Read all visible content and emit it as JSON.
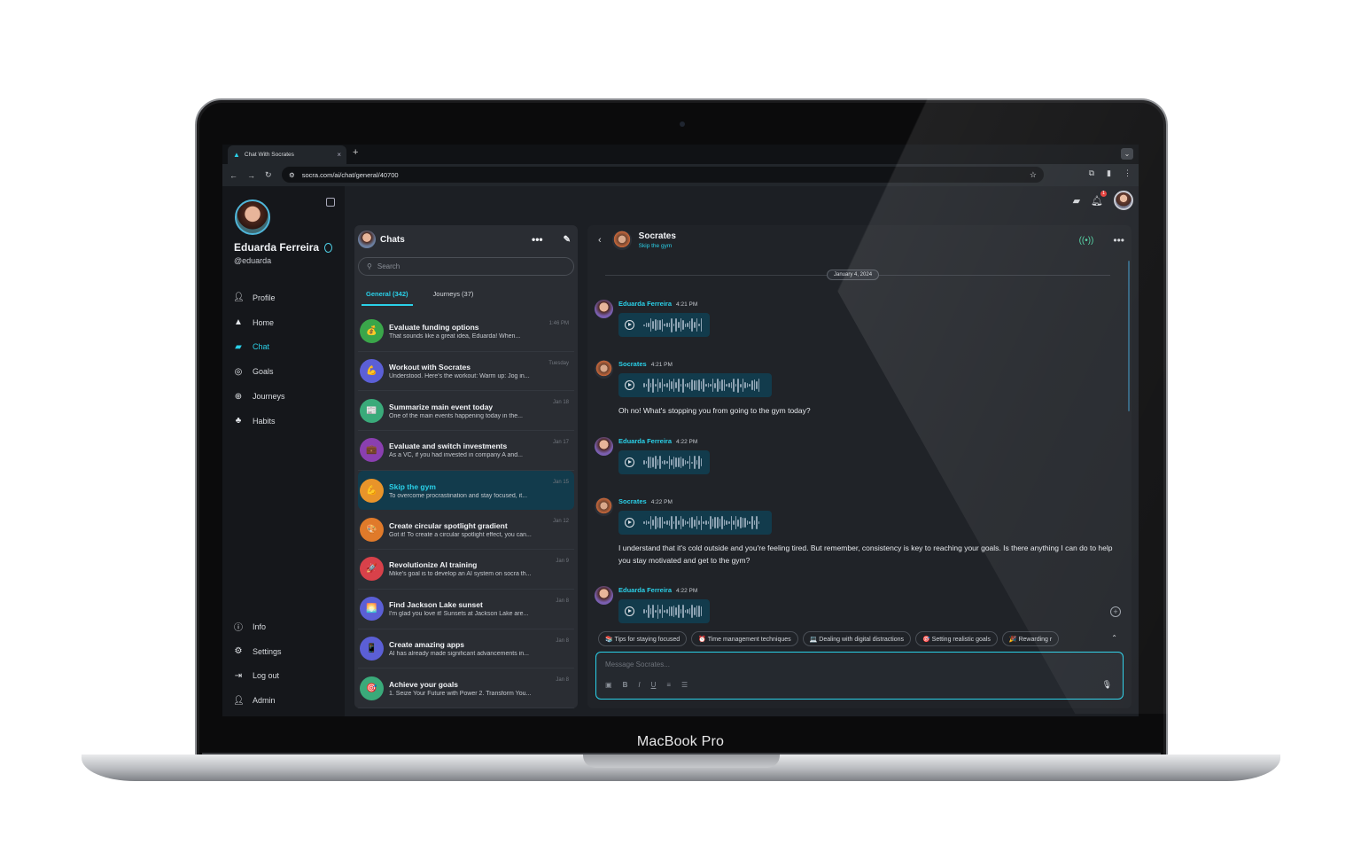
{
  "device": {
    "label": "MacBook Pro"
  },
  "browser": {
    "tab_title": "Chat With Socrates",
    "new_tab": "+",
    "url": "socra.com/ai/chat/general/40700"
  },
  "user": {
    "name": "Eduarda Ferreira",
    "handle": "@eduarda",
    "notifications": "1"
  },
  "nav": {
    "primary": [
      {
        "label": "Profile",
        "icon": "person-icon"
      },
      {
        "label": "Home",
        "icon": "home-icon"
      },
      {
        "label": "Chat",
        "icon": "chat-icon",
        "active": true
      },
      {
        "label": "Goals",
        "icon": "target-icon"
      },
      {
        "label": "Journeys",
        "icon": "globe-icon"
      },
      {
        "label": "Habits",
        "icon": "plant-icon"
      }
    ],
    "secondary": [
      {
        "label": "Info",
        "icon": "info-icon"
      },
      {
        "label": "Settings",
        "icon": "gear-icon"
      },
      {
        "label": "Log out",
        "icon": "logout-icon"
      },
      {
        "label": "Admin",
        "icon": "person-icon"
      }
    ]
  },
  "chat_list": {
    "title": "Chats",
    "search_placeholder": "Search",
    "tabs": [
      "General (342)",
      "Journeys (37)"
    ],
    "items": [
      {
        "title": "Evaluate funding options",
        "snippet": "That sounds like a great idea, Eduarda! When...",
        "date": "1:46 PM",
        "color": "#3aa64a",
        "emoji": "💰"
      },
      {
        "title": "Workout with Socrates",
        "snippet": "Understood. Here's the workout: Warm up: Jog in...",
        "date": "Tuesday",
        "color": "#5b5fd6",
        "emoji": "💪"
      },
      {
        "title": "Summarize main event today",
        "snippet": "One of the main events happening today in the...",
        "date": "Jan 18",
        "color": "#3aaa7a",
        "emoji": "📰"
      },
      {
        "title": "Evaluate and switch investments",
        "snippet": "As a VC, if you had invested in company A and...",
        "date": "Jan 17",
        "color": "#8a3fb0",
        "emoji": "💼"
      },
      {
        "title": "Skip the gym",
        "snippet": "To overcome procrastination and stay focused, it...",
        "date": "Jan 15",
        "color": "#e8942a",
        "emoji": "💪",
        "selected": true
      },
      {
        "title": "Create circular spotlight gradient",
        "snippet": "Got it! To create a circular spotlight effect, you can...",
        "date": "Jan 12",
        "color": "#e07a2a",
        "emoji": "🎨"
      },
      {
        "title": "Revolutionize AI training",
        "snippet": "Mike's goal is to develop an AI system on socra th...",
        "date": "Jan 9",
        "color": "#d8414a",
        "emoji": "🚀"
      },
      {
        "title": "Find Jackson Lake sunset",
        "snippet": "I'm glad you love it! Sunsets at Jackson Lake are...",
        "date": "Jan 8",
        "color": "#5b5fd6",
        "emoji": "🌅"
      },
      {
        "title": "Create amazing apps",
        "snippet": "AI has already made significant advancements in...",
        "date": "Jan 8",
        "color": "#5b5fd6",
        "emoji": "📱"
      },
      {
        "title": "Achieve your goals",
        "snippet": "1. Seize Your Future with Power 2. Transform You...",
        "date": "Jan 8",
        "color": "#3aaa7a",
        "emoji": "🎯"
      }
    ]
  },
  "conversation": {
    "bot_name": "Socrates",
    "subtitle": "Skip the gym",
    "date": "January 4, 2024",
    "messages": [
      {
        "author": "Eduarda Ferreira",
        "time": "4:21 PM",
        "kind": "ed",
        "voice_width": 103,
        "text": ""
      },
      {
        "author": "Socrates",
        "time": "4:21 PM",
        "kind": "so",
        "voice_width": 173,
        "text": "Oh no! What's stopping you from going to the gym today?"
      },
      {
        "author": "Eduarda Ferreira",
        "time": "4:22 PM",
        "kind": "ed",
        "voice_width": 103,
        "text": ""
      },
      {
        "author": "Socrates",
        "time": "4:22 PM",
        "kind": "so",
        "voice_width": 173,
        "text": "I understand that it's cold outside and you're feeling tired. But remember, consistency is key to reaching your goals. Is there anything I can do to help you stay motivated and get to the gym?"
      },
      {
        "author": "Eduarda Ferreira",
        "time": "4:22 PM",
        "kind": "ed",
        "voice_width": 103,
        "text": ""
      }
    ],
    "suggestions": [
      "📚 Tips for staying focused",
      "⏰ Time management techniques",
      "💻 Dealing with digital distractions",
      "🎯 Setting realistic goals",
      "🎉 Rewarding r"
    ],
    "composer_placeholder": "Message Socrates..."
  }
}
